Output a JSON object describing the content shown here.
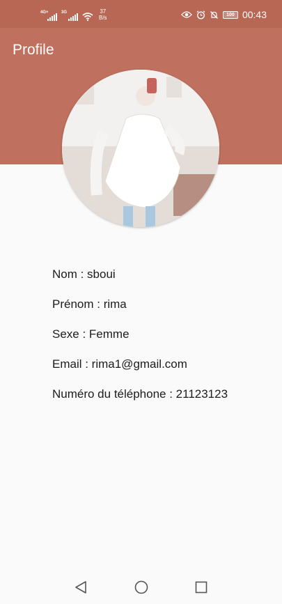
{
  "status_bar": {
    "signal1_label": "4G+",
    "signal2_label": "3G",
    "speed_value": "37",
    "speed_unit": "B/s",
    "battery": "100",
    "time": "00:43"
  },
  "header": {
    "title": "Profile"
  },
  "profile": {
    "nom": "Nom : sboui",
    "prenom": "Prénom : rima",
    "sexe": "Sexe : Femme",
    "email": "Email : rima1@gmail.com",
    "telephone": "Numéro du téléphone : 21123123"
  },
  "colors": {
    "status_bar": "#b96755",
    "header": "#c0705e",
    "background": "#fafafa"
  },
  "icons": [
    "eye-icon",
    "alarm-icon",
    "mute-icon",
    "battery-icon",
    "back-icon",
    "home-icon",
    "recents-icon"
  ]
}
